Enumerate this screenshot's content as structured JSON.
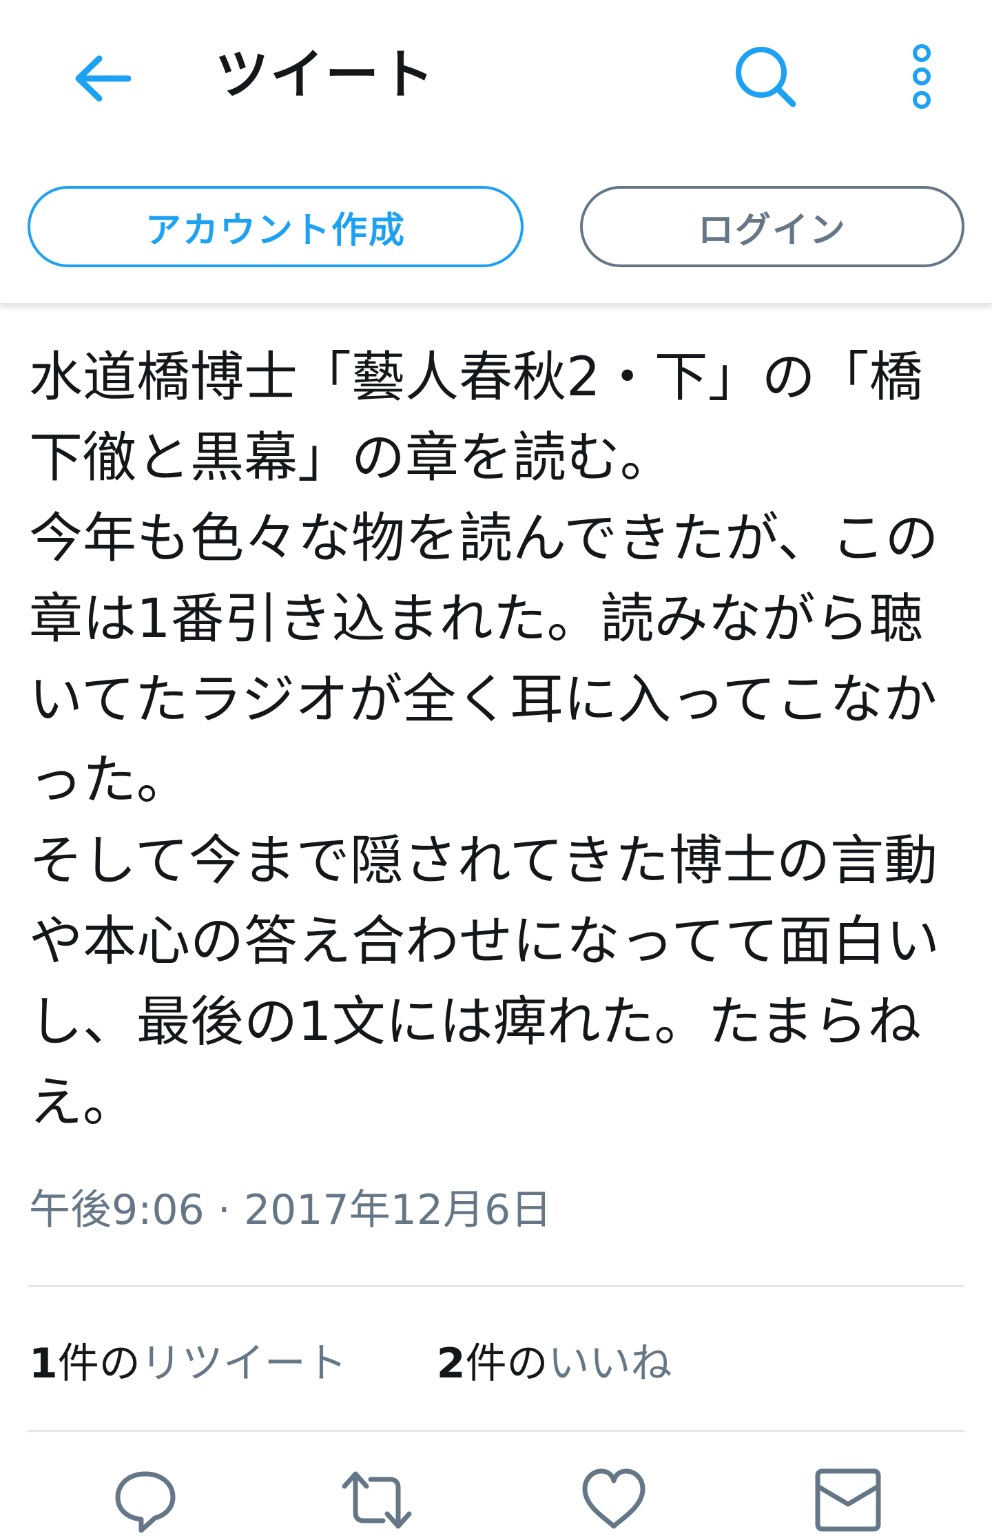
{
  "header": {
    "title": "ツイート",
    "signup_label": "アカウント作成",
    "login_label": "ログイン"
  },
  "tweet": {
    "lines": [
      "水道橋博士「藝人春秋2・下」の「橋",
      "下徹と黒幕」の章を読む。",
      "今年も色々な物を読んできたが、この",
      "章は1番引き込まれた。読みながら聴",
      "いてたラジオが全く耳に入ってこなか",
      "った。",
      "そして今まで隠されてきた博士の言動",
      "や本心の答え合わせになってて面白い",
      "し、最後の1文には痺れた。たまらね",
      "え。"
    ],
    "timestamp": "午後9:06 · 2017年12月6日"
  },
  "stats": {
    "retweets": {
      "count": "1",
      "unit": "件の",
      "label": "リツイート"
    },
    "likes": {
      "count": "2",
      "unit": "件の",
      "label": "いいね"
    }
  },
  "icons": {
    "back": "arrow-left-icon",
    "search": "search-icon",
    "more": "more-vertical-icon",
    "reply": "reply-icon",
    "retweet": "retweet-icon",
    "like": "heart-icon",
    "dm": "envelope-icon"
  },
  "colors": {
    "accent": "#1da1f2",
    "secondary_text": "#657786",
    "action_icons": "#657786",
    "divider": "#e1e8ed"
  }
}
